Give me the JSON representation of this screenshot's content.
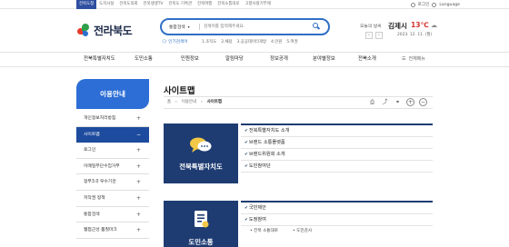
{
  "top_links": [
    "전북도청",
    "도지사실",
    "전북도의회",
    "전북생생TV",
    "전북도 기록관",
    "전북여행",
    "전북소통대로",
    "고향사랑기부제"
  ],
  "top_util": {
    "login": "로그인",
    "language": "Language"
  },
  "logo": {
    "text": "전라북도"
  },
  "search": {
    "category": "통합검색",
    "placeholder": "검색어를 입력해주세요."
  },
  "popular": {
    "label": "인기검색어",
    "keywords": [
      "1.조직도",
      "2.채용",
      "3.공공데이터개방",
      "4.민원",
      "5.여권"
    ]
  },
  "weather": {
    "label": "오늘의 날씨",
    "city": "김제시",
    "temp": "13℃",
    "date": "2023. 12. 11. (월)"
  },
  "gnb": {
    "items": [
      "전북특별자치도",
      "도민소통",
      "민원정보",
      "알림마당",
      "정보공개",
      "분야별정보",
      "전북소개"
    ],
    "all_menu": "전체메뉴"
  },
  "sidebar": {
    "title": "이용안내",
    "items": [
      {
        "label": "개인정보처리방침",
        "toggle": "+"
      },
      {
        "label": "사이트맵",
        "toggle": "−",
        "active": true
      },
      {
        "label": "로그인",
        "toggle": "+"
      },
      {
        "label": "이메일무단수집거부",
        "toggle": "+"
      },
      {
        "label": "정부3.0 우수기관",
        "toggle": "+"
      },
      {
        "label": "저작권 정책",
        "toggle": "+"
      },
      {
        "label": "통합검색",
        "toggle": "+"
      },
      {
        "label": "웹접근성 품질마크",
        "toggle": "+"
      }
    ]
  },
  "page": {
    "title": "사이트맵",
    "breadcrumb": [
      "홈",
      "이용안내",
      "사이트맵"
    ]
  },
  "sitemap": [
    {
      "title": "전북특별자치도",
      "links": [
        "전북특별자치도 소개",
        "브랜드 소통플랫폼",
        "브랜드위원회 소개",
        "도민참여단"
      ]
    },
    {
      "title": "도민소통",
      "links": [
        "국민제안",
        "도정참여"
      ],
      "sub": [
        "전북 소통대로",
        "도민감사"
      ]
    }
  ],
  "colors": {
    "primary": "#2c6ed5",
    "navy": "#1e3c72",
    "temp": "#d4312c"
  }
}
